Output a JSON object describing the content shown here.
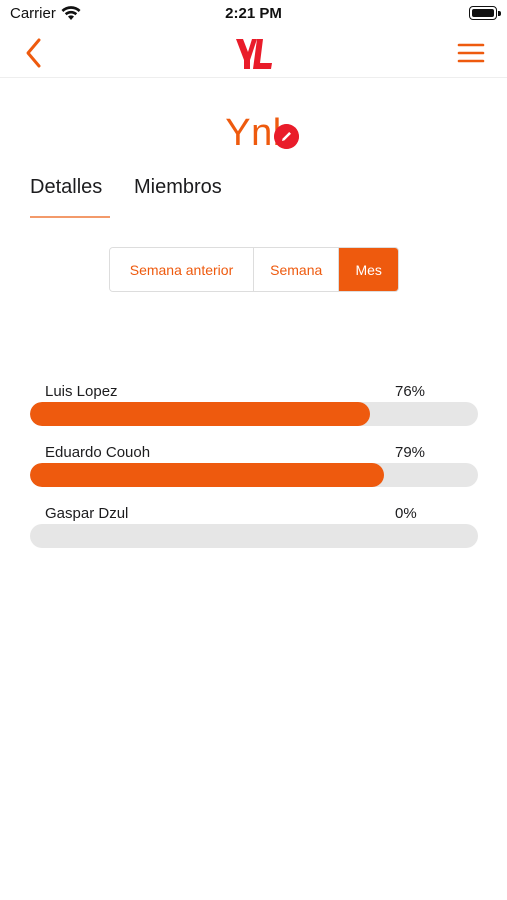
{
  "status_bar": {
    "carrier": "Carrier",
    "time": "2:21 PM"
  },
  "nav": {
    "back_icon": "chevron-left-icon",
    "logo_text": "YL",
    "menu_icon": "hamburger-menu-icon"
  },
  "team": {
    "name": "Ynl",
    "edit_icon": "pencil-icon"
  },
  "tabs": [
    {
      "label": "Detalles",
      "active": true
    },
    {
      "label": "Miembros",
      "active": false
    }
  ],
  "period_selector": {
    "options": [
      {
        "label": "Semana anterior",
        "selected": false
      },
      {
        "label": "Semana",
        "selected": false
      },
      {
        "label": "Mes",
        "selected": true
      }
    ]
  },
  "members": [
    {
      "name": "Luis Lopez",
      "percent_label": "76%",
      "progress": 0.76
    },
    {
      "name": "Eduardo Couoh",
      "percent_label": "79%",
      "progress": 0.79
    },
    {
      "name": "Gaspar Dzul",
      "percent_label": "0%",
      "progress": 0.0
    }
  ],
  "colors": {
    "accent": "#ee5a0e",
    "edit_badge": "#e91c2a",
    "track": "#e6e6e6"
  }
}
